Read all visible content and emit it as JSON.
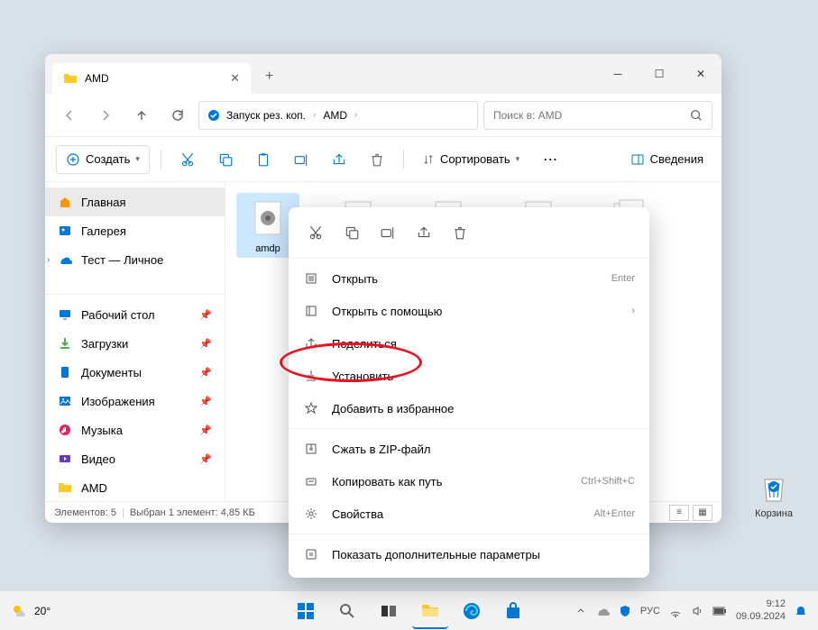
{
  "tab": {
    "title": "AMD"
  },
  "breadcrumb": {
    "root": "Запуск рез. коп.",
    "current": "AMD"
  },
  "search": {
    "placeholder": "Поиск в: AMD"
  },
  "toolbar": {
    "create": "Создать",
    "sort": "Сортировать",
    "details": "Сведения"
  },
  "sidebar": {
    "items": [
      {
        "label": "Главная",
        "icon": "home"
      },
      {
        "label": "Галерея",
        "icon": "gallery"
      },
      {
        "label": "Тест — Личное",
        "icon": "onedrive",
        "expandable": true
      }
    ],
    "quick": [
      {
        "label": "Рабочий стол",
        "icon": "desktop"
      },
      {
        "label": "Загрузки",
        "icon": "downloads"
      },
      {
        "label": "Документы",
        "icon": "documents"
      },
      {
        "label": "Изображения",
        "icon": "pictures"
      },
      {
        "label": "Музыка",
        "icon": "music"
      },
      {
        "label": "Видео",
        "icon": "video"
      },
      {
        "label": "AMD",
        "icon": "folder"
      }
    ]
  },
  "files": [
    {
      "name": "amdp",
      "selected": true
    }
  ],
  "status": {
    "count": "Элементов: 5",
    "selection": "Выбран 1 элемент: 4,85 КБ"
  },
  "context": {
    "open": "Открыть",
    "open_sc": "Enter",
    "open_with": "Открыть с помощью",
    "share": "Поделиться",
    "install": "Установить",
    "favorite": "Добавить в избранное",
    "zip": "Сжать в ZIP-файл",
    "copy_path": "Копировать как путь",
    "copy_path_sc": "Ctrl+Shift+C",
    "props": "Свойства",
    "props_sc": "Alt+Enter",
    "more": "Показать дополнительные параметры"
  },
  "desktop": {
    "recycle": "Корзина"
  },
  "taskbar": {
    "temp": "20°",
    "lang": "РУС",
    "time": "9:12",
    "date": "09.09.2024"
  }
}
